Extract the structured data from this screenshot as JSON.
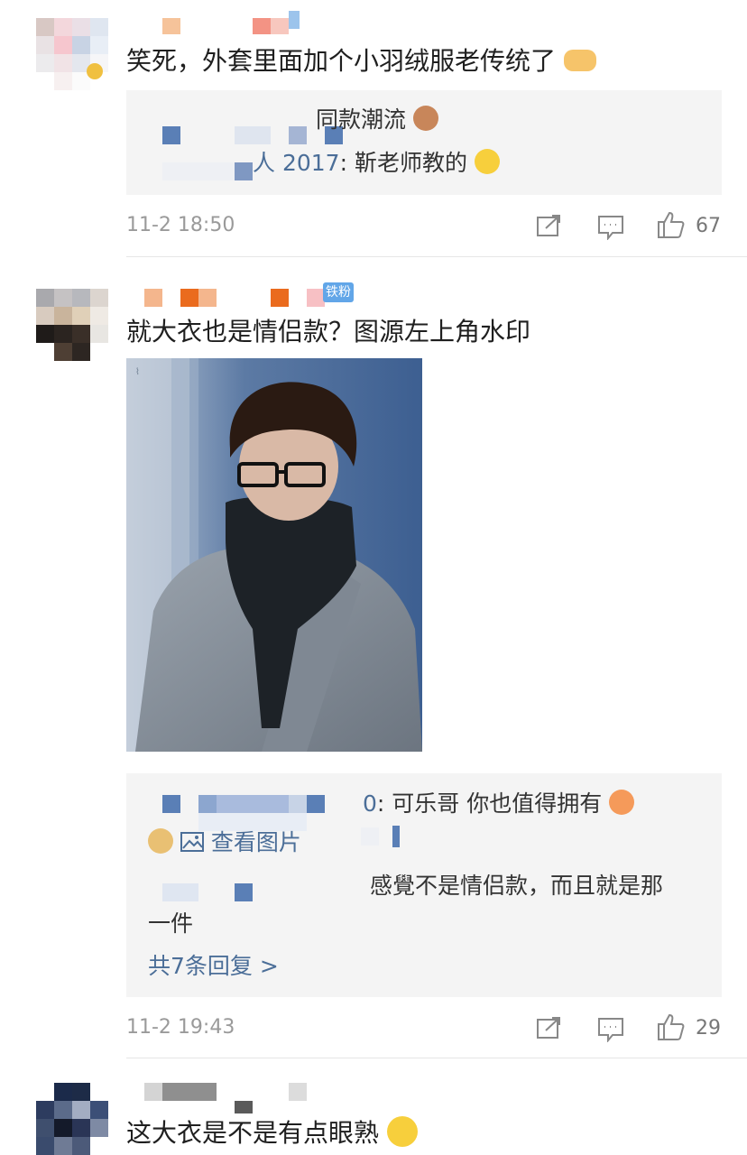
{
  "comments": [
    {
      "text": "笑死，外套里面加个小羽绒服老传统了",
      "replies": [
        {
          "text": "同款潮流"
        },
        {
          "prefix": "人 2017",
          "text": ": 靳老师教的"
        }
      ],
      "time": "11-2 18:50",
      "likes": "67"
    },
    {
      "badge": "铁粉",
      "text": "就大衣也是情侣款？图源左上角水印",
      "replies": [
        {
          "prefix": "0",
          "text": ": 可乐哥  你也值得拥有"
        },
        {
          "link": "查看图片"
        },
        {
          "text": "感覺不是情侣款，而且就是那"
        },
        {
          "text": "一件"
        }
      ],
      "more_replies": "共7条回复 >",
      "time": "11-2 19:43",
      "likes": "29"
    },
    {
      "text": "这大衣是不是有点眼熟"
    }
  ],
  "icons": {
    "share": "share-icon",
    "comment": "comment-icon",
    "like": "thumbs-up-icon",
    "emoji_handshake": "handshake-emoji",
    "emoji_tom": "cat-emoji",
    "emoji_laugh": "laugh-cry-emoji",
    "emoji_kiss": "kiss-emoji",
    "emoji_doge": "doge-emoji",
    "image": "image-icon"
  },
  "colors": {
    "link_blue": "#4b6e98",
    "reply_bg": "#f4f4f4",
    "meta_gray": "#9a9a9a"
  }
}
